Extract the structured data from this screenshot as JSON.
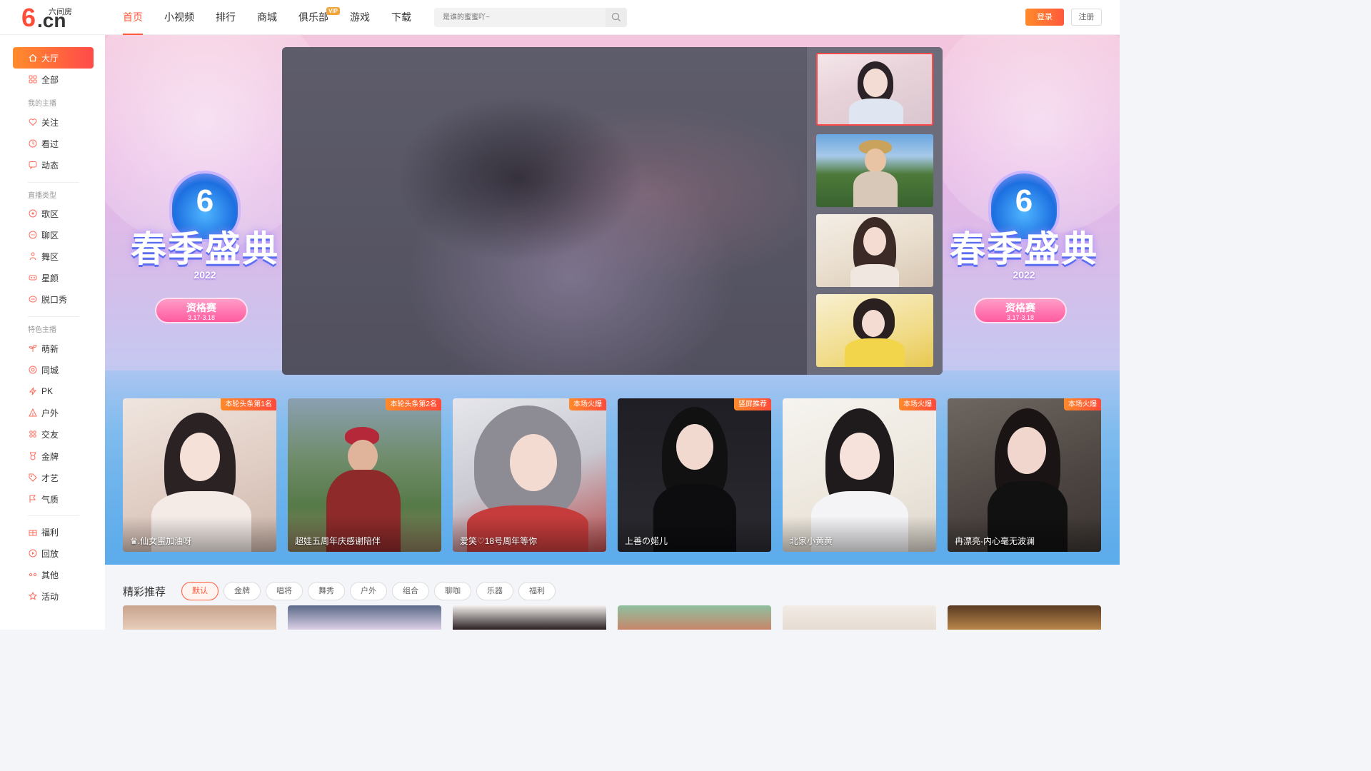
{
  "brand": {
    "name": "六间房",
    "logo_mark": "6",
    "logo_domain": ".cn"
  },
  "nav": {
    "items": [
      {
        "label": "首页",
        "active": true
      },
      {
        "label": "小视频"
      },
      {
        "label": "排行"
      },
      {
        "label": "商城"
      },
      {
        "label": "俱乐部",
        "badge": "VIP"
      },
      {
        "label": "游戏"
      },
      {
        "label": "下载"
      }
    ]
  },
  "search": {
    "placeholder": "是谁的蜜蜜吖~",
    "icon": "search-icon"
  },
  "auth": {
    "login": "登录",
    "register": "注册"
  },
  "sidebar": {
    "active": {
      "label": "大厅",
      "icon": "home-icon"
    },
    "all": {
      "label": "全部",
      "icon": "grid-icon"
    },
    "group_my": "我的主播",
    "my": [
      {
        "label": "关注",
        "icon": "heart-icon"
      },
      {
        "label": "看过",
        "icon": "clock-icon"
      },
      {
        "label": "动态",
        "icon": "chat-icon"
      }
    ],
    "group_type": "直播类型",
    "types": [
      {
        "label": "歌区",
        "icon": "music-icon"
      },
      {
        "label": "聊区",
        "icon": "bubble-icon"
      },
      {
        "label": "舞区",
        "icon": "dance-icon"
      },
      {
        "label": "星颜",
        "icon": "mask-icon"
      },
      {
        "label": "脱口秀",
        "icon": "mic-icon"
      }
    ],
    "group_special": "特色主播",
    "special": [
      {
        "label": "萌新",
        "icon": "sprout-icon"
      },
      {
        "label": "同城",
        "icon": "location-icon"
      },
      {
        "label": "PK",
        "icon": "lightning-icon"
      },
      {
        "label": "户外",
        "icon": "tent-icon"
      },
      {
        "label": "交友",
        "icon": "people-icon"
      },
      {
        "label": "金牌",
        "icon": "medal-icon"
      },
      {
        "label": "才艺",
        "icon": "tag-icon"
      },
      {
        "label": "气质",
        "icon": "flag-icon"
      }
    ],
    "misc": [
      {
        "label": "福利",
        "icon": "gift-icon"
      },
      {
        "label": "回放",
        "icon": "replay-icon"
      },
      {
        "label": "其他",
        "icon": "more-icon"
      },
      {
        "label": "活动",
        "icon": "star-icon"
      }
    ]
  },
  "banner": {
    "title": "春季盛典",
    "year": "2022",
    "mark": "6",
    "pill_title": "资格赛",
    "pill_date": "3.17-3.18"
  },
  "colors": {
    "accent": "#ff5a3c",
    "accent_grad_start": "#ff8c2b",
    "accent_grad_end": "#ff4a4a"
  },
  "top_cards": [
    {
      "name": "♛.仙女蜜加油呀",
      "tag": "本轮头条第1名"
    },
    {
      "name": "超娃五周年庆感谢陪伴",
      "tag": "本轮头条第2名"
    },
    {
      "name": "爱笑♡18号周年等你",
      "tag": "本场火爆"
    },
    {
      "name": "上善の婼儿",
      "tag": "竖屏推荐"
    },
    {
      "name": "北家小黄黄",
      "tag": "本场火爆"
    },
    {
      "name": "冉漂亮-内心毫无波澜",
      "tag": "本场火爆"
    }
  ],
  "recommend": {
    "title": "精彩推荐",
    "filters": [
      "默认",
      "金牌",
      "唱将",
      "舞秀",
      "户外",
      "组合",
      "聊咖",
      "乐器",
      "福利"
    ]
  }
}
